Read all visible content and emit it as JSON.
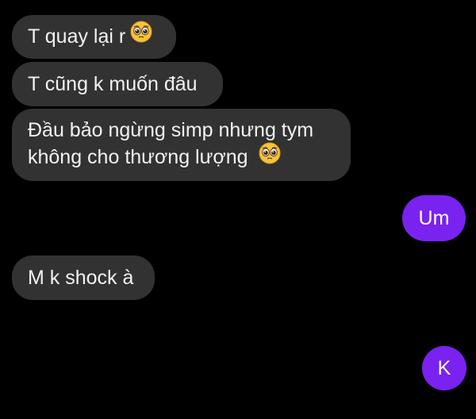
{
  "messages": [
    {
      "sender": "them",
      "text": "T quay lại r",
      "emoji": "pleading-face-icon"
    },
    {
      "sender": "them",
      "text": "T cũng k muốn đâu"
    },
    {
      "sender": "them",
      "lines": [
        "Đầu bảo ngừng simp nhưng tym",
        "không cho thương lượng"
      ],
      "emoji": "pleading-face-icon"
    },
    {
      "sender": "me",
      "text": "Um"
    },
    {
      "sender": "them",
      "text": "M k shock à"
    },
    {
      "sender": "me",
      "text": "K"
    }
  ],
  "colors": {
    "background": "#000000",
    "incoming_bubble": "#323232",
    "outgoing_bubble": "#7a22f0",
    "text": "#f2f2f2"
  }
}
